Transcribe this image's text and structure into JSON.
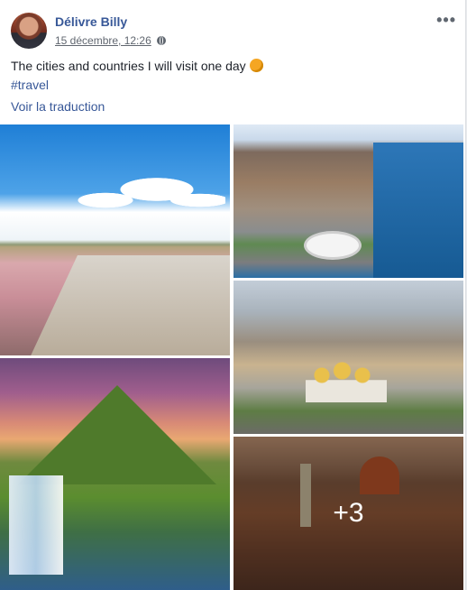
{
  "post": {
    "author": "Délivre Billy",
    "date": "15 décembre, 12:26",
    "privacy_icon": "globe-icon",
    "more_label": "•••",
    "text": "The cities and countries I will visit one day",
    "emoji_icon": "muscle-emoji-icon",
    "hashtag": "#travel",
    "translate_link": "Voir la traduction",
    "photos": [
      {
        "name": "photo-salt-road"
      },
      {
        "name": "photo-cape-town"
      },
      {
        "name": "photo-moscow-kremlin"
      },
      {
        "name": "photo-kirkjufell"
      },
      {
        "name": "photo-florence",
        "more_count": "+3"
      }
    ]
  }
}
